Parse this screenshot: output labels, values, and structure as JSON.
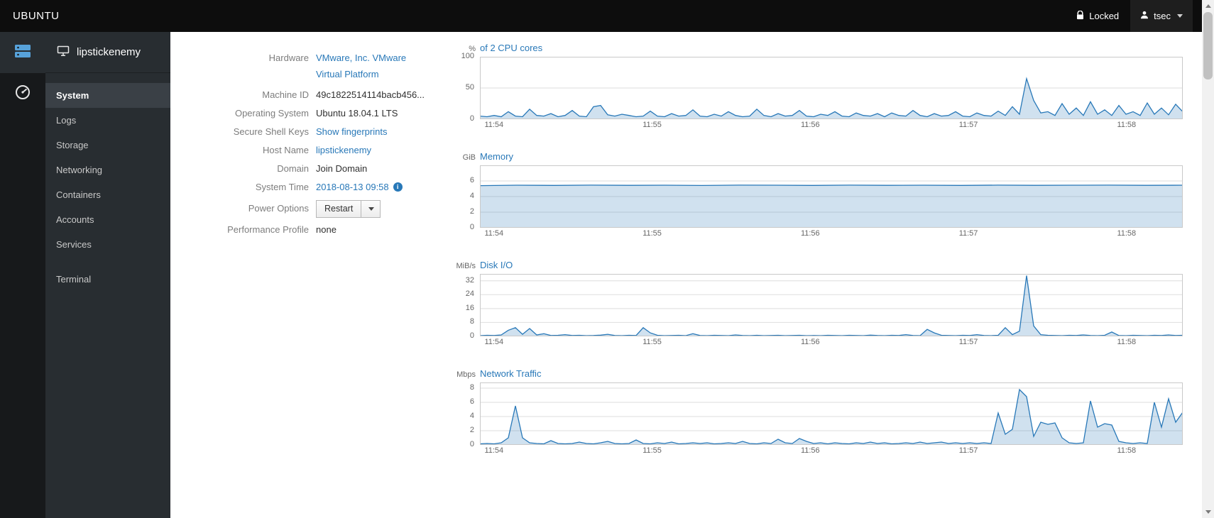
{
  "topbar": {
    "brand": "UBUNTU",
    "locked_label": "Locked",
    "user_label": "tsec"
  },
  "sidebar": {
    "host": "lipstickenemy",
    "items": [
      {
        "label": "System",
        "active": true
      },
      {
        "label": "Logs"
      },
      {
        "label": "Storage"
      },
      {
        "label": "Networking"
      },
      {
        "label": "Containers"
      },
      {
        "label": "Accounts"
      },
      {
        "label": "Services"
      },
      {
        "label": "Terminal"
      }
    ]
  },
  "system": {
    "fields": [
      {
        "label": "Hardware",
        "value": "VMware, Inc. VMware Virtual Platform"
      },
      {
        "label": "Machine ID",
        "value": "49c1822514114bacb456..."
      },
      {
        "label": "Operating System",
        "value": "Ubuntu 18.04.1 LTS"
      },
      {
        "label": "Secure Shell Keys",
        "value": "Show fingerprints"
      },
      {
        "label": "Host Name",
        "value": "lipstickenemy"
      },
      {
        "label": "Domain",
        "value": "Join Domain"
      },
      {
        "label": "System Time",
        "value": "2018-08-13 09:58"
      },
      {
        "label": "Power Options",
        "value": "Restart"
      },
      {
        "label": "Performance Profile",
        "value": "none"
      }
    ]
  },
  "icons": {
    "lock": "lock-icon",
    "user": "user-icon",
    "caret_down": "caret-down-icon",
    "machines": "server-icon",
    "dashboard": "dashboard-icon",
    "host": "host-icon",
    "info": "info-icon",
    "scroll_up": "scroll-up-arrow-icon",
    "scroll_down": "scroll-down-arrow-icon"
  },
  "colors": {
    "accent_link": "#2878b8",
    "chart_line": "#2878b8",
    "chart_fill": "rgba(40,120,181,0.22)",
    "topbar_bg": "#0d0d0d",
    "sidebar_bg": "#282d31"
  },
  "chart_data": [
    {
      "type": "area",
      "title": "of 2 CPU cores",
      "unit": "%",
      "ylim": [
        0,
        100
      ],
      "yticks": [
        0,
        50,
        100
      ],
      "x_ticks": [
        "11:54",
        "11:55",
        "11:56",
        "11:57",
        "11:58"
      ],
      "xtick_fracs": [
        0.02,
        0.245,
        0.47,
        0.695,
        0.92
      ],
      "series": [
        {
          "name": "cpu_percent",
          "values": [
            5,
            4,
            6,
            4,
            12,
            5,
            4,
            16,
            6,
            5,
            9,
            4,
            6,
            14,
            5,
            4,
            20,
            22,
            7,
            5,
            8,
            6,
            4,
            5,
            13,
            5,
            4,
            9,
            5,
            6,
            15,
            5,
            4,
            8,
            5,
            12,
            6,
            4,
            5,
            16,
            6,
            4,
            9,
            5,
            6,
            14,
            5,
            4,
            8,
            6,
            12,
            5,
            4,
            10,
            6,
            5,
            9,
            4,
            10,
            6,
            5,
            14,
            6,
            4,
            9,
            5,
            6,
            12,
            5,
            4,
            10,
            6,
            5,
            13,
            6,
            20,
            8,
            65,
            30,
            10,
            12,
            6,
            25,
            8,
            18,
            6,
            28,
            8,
            15,
            6,
            22,
            8,
            12,
            6,
            26,
            8,
            18,
            7,
            24,
            12
          ]
        }
      ]
    },
    {
      "type": "area",
      "title": "Memory",
      "unit": "GiB",
      "ylim": [
        0,
        8
      ],
      "yticks": [
        0,
        2,
        4,
        6
      ],
      "x_ticks": [
        "11:54",
        "11:55",
        "11:56",
        "11:57",
        "11:58"
      ],
      "xtick_fracs": [
        0.02,
        0.245,
        0.47,
        0.695,
        0.92
      ],
      "series": [
        {
          "name": "memory_used_gib",
          "values": [
            5.4,
            5.45,
            5.43,
            5.46,
            5.44,
            5.45,
            5.42,
            5.46,
            5.45,
            5.43,
            5.46,
            5.44,
            5.45,
            5.43,
            5.46,
            5.44,
            5.45,
            5.46,
            5.44,
            5.45
          ]
        }
      ]
    },
    {
      "type": "area",
      "title": "Disk I/O",
      "unit": "MiB/s",
      "ylim": [
        0,
        36
      ],
      "yticks": [
        0,
        8,
        16,
        24,
        32
      ],
      "x_ticks": [
        "11:54",
        "11:55",
        "11:56",
        "11:57",
        "11:58"
      ],
      "xtick_fracs": [
        0.02,
        0.245,
        0.47,
        0.695,
        0.92
      ],
      "series": [
        {
          "name": "disk_io_mibs",
          "values": [
            0.4,
            0.6,
            0.5,
            0.8,
            3.5,
            5,
            1.2,
            4.5,
            0.8,
            1.5,
            0.5,
            0.6,
            1,
            0.5,
            0.6,
            0.4,
            0.5,
            0.7,
            1.2,
            0.5,
            0.4,
            0.6,
            0.5,
            5,
            2,
            0.6,
            0.4,
            0.5,
            0.6,
            0.4,
            1.5,
            0.5,
            0.4,
            0.6,
            0.5,
            0.4,
            0.8,
            0.5,
            0.4,
            0.6,
            0.4,
            0.5,
            0.6,
            0.4,
            0.5,
            0.6,
            0.4,
            0.5,
            0.4,
            0.6,
            0.5,
            0.4,
            0.6,
            0.5,
            0.4,
            0.7,
            0.5,
            0.4,
            0.6,
            0.5,
            1,
            0.5,
            0.4,
            4,
            2,
            0.6,
            0.5,
            0.4,
            0.6,
            0.5,
            1,
            0.5,
            0.4,
            0.6,
            5,
            1,
            3,
            35,
            6,
            1,
            0.6,
            0.5,
            0.4,
            0.6,
            0.5,
            0.8,
            0.5,
            0.4,
            0.6,
            2.5,
            0.5,
            0.4,
            0.6,
            0.5,
            0.4,
            0.6,
            0.5,
            0.8,
            0.5,
            0.6
          ]
        }
      ]
    },
    {
      "type": "area",
      "title": "Network Traffic",
      "unit": "Mbps",
      "ylim": [
        0,
        8.8
      ],
      "yticks": [
        0,
        2,
        4,
        6,
        8
      ],
      "x_ticks": [
        "11:54",
        "11:55",
        "11:56",
        "11:57",
        "11:58"
      ],
      "xtick_fracs": [
        0.02,
        0.245,
        0.47,
        0.695,
        0.92
      ],
      "series": [
        {
          "name": "network_mbps",
          "values": [
            0.15,
            0.2,
            0.15,
            0.3,
            1,
            5.5,
            1,
            0.3,
            0.2,
            0.15,
            0.6,
            0.2,
            0.15,
            0.2,
            0.4,
            0.2,
            0.15,
            0.3,
            0.5,
            0.2,
            0.15,
            0.2,
            0.7,
            0.2,
            0.15,
            0.3,
            0.2,
            0.4,
            0.15,
            0.2,
            0.3,
            0.2,
            0.3,
            0.15,
            0.2,
            0.3,
            0.2,
            0.5,
            0.2,
            0.15,
            0.3,
            0.2,
            0.8,
            0.3,
            0.2,
            0.9,
            0.5,
            0.2,
            0.3,
            0.15,
            0.3,
            0.2,
            0.15,
            0.3,
            0.2,
            0.4,
            0.2,
            0.3,
            0.15,
            0.2,
            0.3,
            0.2,
            0.4,
            0.2,
            0.3,
            0.4,
            0.2,
            0.3,
            0.2,
            0.3,
            0.2,
            0.3,
            0.2,
            4.5,
            1.5,
            2.2,
            7.8,
            6.8,
            1.2,
            3.2,
            2.9,
            3.1,
            1,
            0.3,
            0.2,
            0.3,
            6.2,
            2.5,
            3,
            2.8,
            0.5,
            0.3,
            0.2,
            0.3,
            0.2,
            6,
            2.5,
            6.5,
            3.2,
            4.6
          ]
        }
      ]
    }
  ]
}
